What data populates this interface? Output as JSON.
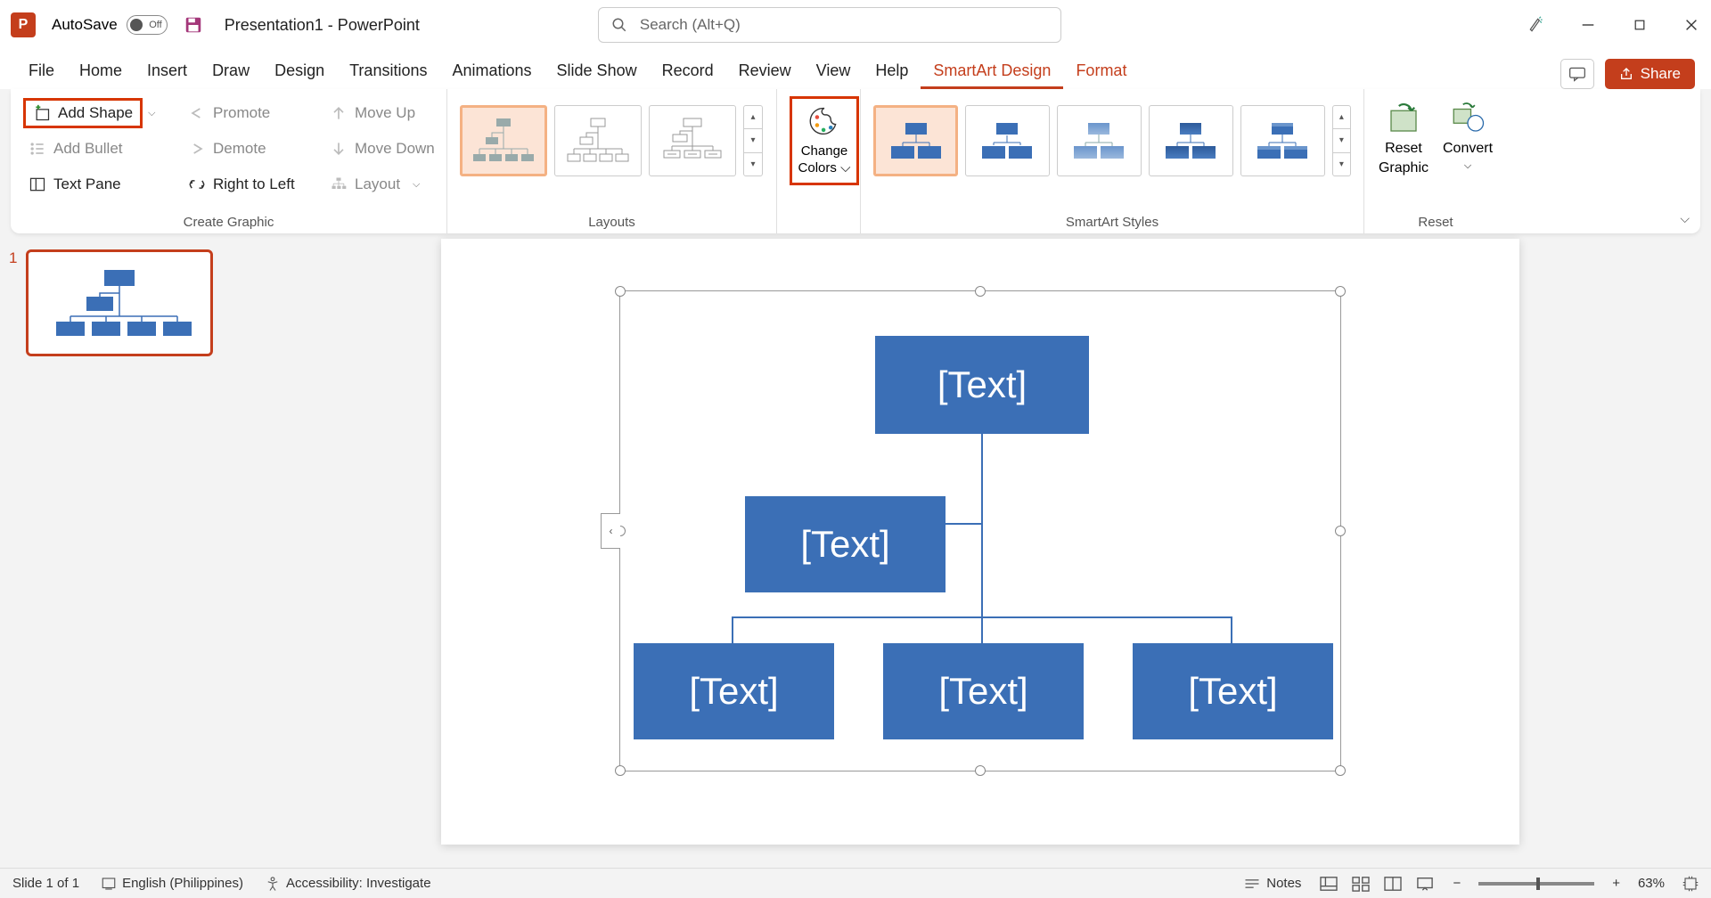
{
  "title_bar": {
    "autosave_label": "AutoSave",
    "autosave_state": "Off",
    "doc_name": "Presentation1  -  PowerPoint",
    "search_placeholder": "Search (Alt+Q)"
  },
  "tabs": [
    "File",
    "Home",
    "Insert",
    "Draw",
    "Design",
    "Transitions",
    "Animations",
    "Slide Show",
    "Record",
    "Review",
    "View",
    "Help",
    "SmartArt Design",
    "Format"
  ],
  "active_tab": "SmartArt Design",
  "share_label": "Share",
  "ribbon": {
    "create_graphic": {
      "add_shape": "Add Shape",
      "add_bullet": "Add Bullet",
      "text_pane": "Text Pane",
      "promote": "Promote",
      "demote": "Demote",
      "right_to_left": "Right to Left",
      "move_up": "Move Up",
      "move_down": "Move Down",
      "layout": "Layout",
      "label": "Create Graphic"
    },
    "layouts_label": "Layouts",
    "change_colors": {
      "line1": "Change",
      "line2": "Colors"
    },
    "styles_label": "SmartArt Styles",
    "reset": {
      "reset_graphic_l1": "Reset",
      "reset_graphic_l2": "Graphic",
      "convert": "Convert",
      "label": "Reset"
    }
  },
  "slide_panel": {
    "slide_number": "1"
  },
  "smartart": {
    "box_text": "[Text]"
  },
  "status": {
    "slide_of": "Slide 1 of 1",
    "language": "English (Philippines)",
    "accessibility": "Accessibility: Investigate",
    "notes": "Notes",
    "zoom": "63%"
  },
  "colors": {
    "accent": "#c43e1c",
    "box": "#3b6fb6"
  }
}
